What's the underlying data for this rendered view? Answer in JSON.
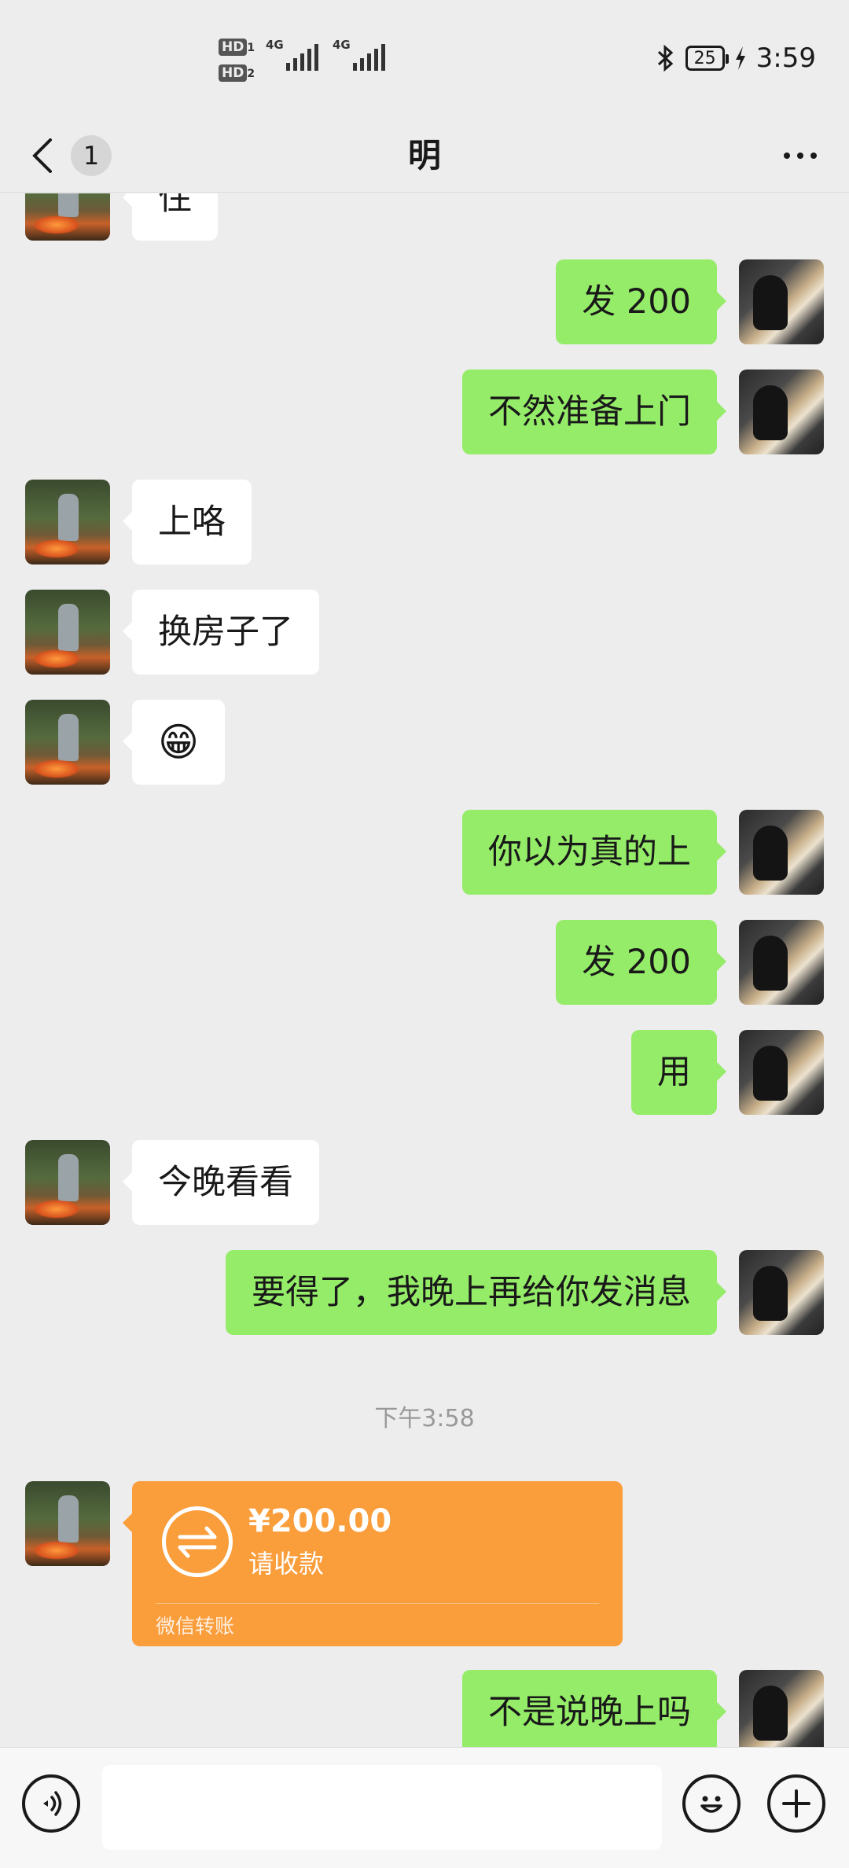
{
  "status_bar": {
    "sim1": "HD",
    "sim1_num": "1",
    "sim2": "HD",
    "sim2_num": "2",
    "net1": "4G",
    "net2": "4G",
    "battery": "25",
    "time": "3:59"
  },
  "nav": {
    "unread_count": "1",
    "title": "明"
  },
  "messages": [
    {
      "side": "left",
      "text": "住"
    },
    {
      "side": "right",
      "text": "发 200"
    },
    {
      "side": "right",
      "text": "不然准备上门"
    },
    {
      "side": "left",
      "text": "上咯"
    },
    {
      "side": "left",
      "text": "换房子了"
    },
    {
      "side": "left",
      "text": "😁"
    },
    {
      "side": "right",
      "text": "你以为真的上"
    },
    {
      "side": "right",
      "text": "发 200"
    },
    {
      "side": "right",
      "text": "用"
    },
    {
      "side": "left",
      "text": "今晚看看"
    },
    {
      "side": "right",
      "text": "要得了，我晚上再给你发消息"
    },
    {
      "side": "right",
      "text": "不是说晚上吗"
    }
  ],
  "timestamp": "下午3:58",
  "transfer": {
    "amount": "¥200.00",
    "status": "请收款",
    "footer": "微信转账"
  },
  "colors": {
    "bubble_mine": "#95ec69",
    "bubble_other": "#ffffff",
    "transfer": "#fa9d3b",
    "background": "#ededed"
  },
  "icons": {
    "back": "chevron-left-icon",
    "more": "more-dots-icon",
    "voice": "voice-icon",
    "emoji": "emoji-icon",
    "plus": "plus-icon"
  }
}
